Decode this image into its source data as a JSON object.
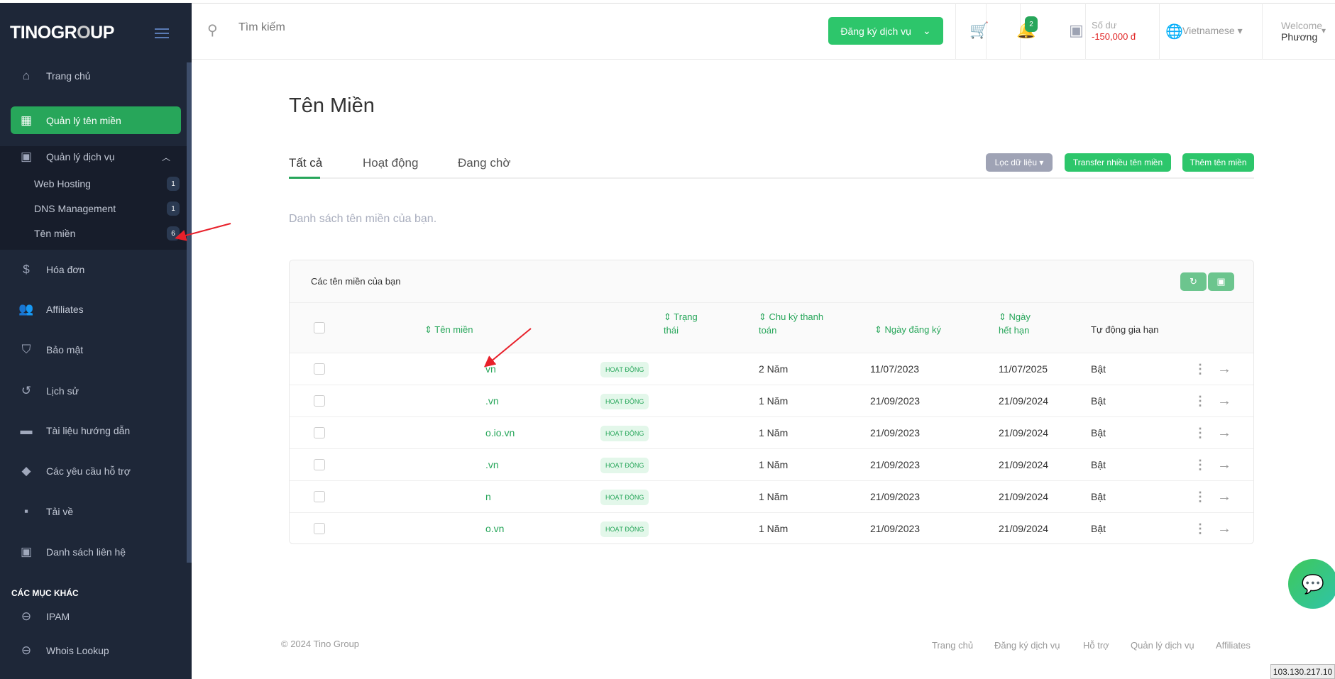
{
  "sidebar": {
    "logo": "TINOGROUP",
    "items": [
      {
        "label": "Trang chủ",
        "icon": "home-icon"
      },
      {
        "label": "Quản lý tên miền",
        "icon": "building-icon"
      },
      {
        "label": "Quản lý dịch vụ",
        "icon": "contact-icon"
      },
      {
        "label": "Hóa đơn",
        "icon": "dollar-icon"
      },
      {
        "label": "Affiliates",
        "icon": "users-plus-icon"
      },
      {
        "label": "Bảo mật",
        "icon": "shield-icon"
      },
      {
        "label": "Lịch sử",
        "icon": "history-icon"
      },
      {
        "label": "Tài liệu hướng dẫn",
        "icon": "document-icon"
      },
      {
        "label": "Các yêu cầu hỗ trợ",
        "icon": "tickets-icon"
      },
      {
        "label": "Tải về",
        "icon": "save-icon"
      },
      {
        "label": "Danh sách liên hệ",
        "icon": "contact-icon"
      }
    ],
    "subitems": [
      {
        "label": "Web Hosting",
        "count": "1"
      },
      {
        "label": "DNS Management",
        "count": "1"
      },
      {
        "label": "Tên miền",
        "count": "6"
      }
    ],
    "section": "CÁC MỤC KHÁC",
    "other": [
      {
        "label": "IPAM"
      },
      {
        "label": "Whois Lookup"
      }
    ]
  },
  "topbar": {
    "search_placeholder": "Tìm kiếm",
    "register": "Đăng ký dịch vụ",
    "notifications": "2",
    "balance_label": "Số dư",
    "balance": "-150,000 đ",
    "language": "Vietnamese",
    "welcome": "Welcome",
    "user": "Phương"
  },
  "main": {
    "title": "Tên Miền",
    "tabs": [
      "Tất cả",
      "Hoạt động",
      "Đang chờ"
    ],
    "filter": "Lọc dữ liệu",
    "transfer": "Transfer nhiều tên miền",
    "add": "Thêm tên miền",
    "description": "Danh sách tên miền của bạn.",
    "card_title": "Các tên miền của bạn",
    "columns": {
      "name": "Tên miền",
      "status1": "Trạng",
      "status2": "thái",
      "cycle1": "Chu kỳ thanh",
      "cycle2": "toán",
      "reg": "Ngày đăng ký",
      "exp1": "Ngày",
      "exp2": "hết hạn",
      "auto": "Tự động gia hạn"
    },
    "rows": [
      {
        "name": "vn",
        "status": "HOẠT ĐỘNG",
        "cycle": "2 Năm",
        "reg": "11/07/2023",
        "exp": "11/07/2025",
        "auto": "Bật"
      },
      {
        "name": ".vn",
        "status": "HOẠT ĐỘNG",
        "cycle": "1 Năm",
        "reg": "21/09/2023",
        "exp": "21/09/2024",
        "auto": "Bật"
      },
      {
        "name": "o.io.vn",
        "status": "HOẠT ĐỘNG",
        "cycle": "1 Năm",
        "reg": "21/09/2023",
        "exp": "21/09/2024",
        "auto": "Bật"
      },
      {
        "name": ".vn",
        "status": "HOẠT ĐỘNG",
        "cycle": "1 Năm",
        "reg": "21/09/2023",
        "exp": "21/09/2024",
        "auto": "Bật"
      },
      {
        "name": "n",
        "status": "HOẠT ĐỘNG",
        "cycle": "1 Năm",
        "reg": "21/09/2023",
        "exp": "21/09/2024",
        "auto": "Bật"
      },
      {
        "name": "o.vn",
        "status": "HOẠT ĐỘNG",
        "cycle": "1 Năm",
        "reg": "21/09/2023",
        "exp": "21/09/2024",
        "auto": "Bật"
      }
    ]
  },
  "footer": {
    "copyright": "© 2024 Tino Group",
    "links": [
      "Trang chủ",
      "Đăng ký dịch vụ",
      "Hỗ trợ",
      "Quản lý dịch vụ",
      "Affiliates"
    ]
  },
  "ip": "103.130.217.10",
  "colors": {
    "accent": "#2dc66b",
    "sidebar": "#1e2738",
    "negative": "#e02424"
  }
}
